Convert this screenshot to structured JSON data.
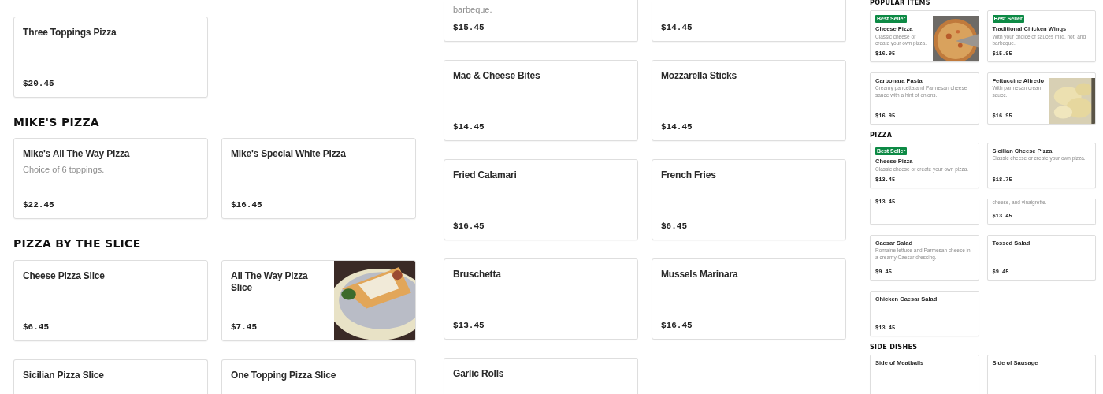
{
  "panels": [
    {
      "kind": "regular",
      "sections": [
        {
          "items": [
            {
              "kind": "full",
              "name": "Three Toppings Pizza",
              "price": "$20.45"
            }
          ]
        },
        {
          "heading": "MIKE'S PIZZA",
          "items": [
            {
              "kind": "full",
              "name": "Mike's All The Way Pizza",
              "description": "Choice of 6 toppings.",
              "price": "$22.45"
            },
            {
              "kind": "full",
              "name": "Mike's Special White Pizza",
              "price": "$16.45"
            }
          ]
        },
        {
          "heading": "PIZZA BY THE SLICE",
          "items": [
            {
              "kind": "full",
              "name": "Cheese Pizza Slice",
              "price": "$6.45"
            },
            {
              "kind": "full",
              "name": "All The Way Pizza Slice",
              "price": "$7.45",
              "picture": true
            },
            {
              "kind": "head",
              "name": "Sicilian Pizza Slice"
            },
            {
              "kind": "head",
              "name": "One Topping Pizza Slice"
            }
          ]
        }
      ]
    },
    {
      "kind": "regular",
      "sections": [
        {
          "items": [
            {
              "kind": "tail",
              "description": "barbeque.",
              "price": "$15.45"
            },
            {
              "kind": "tail",
              "price": "$14.45"
            },
            {
              "kind": "full",
              "name": "Mac & Cheese Bites",
              "price": "$14.45"
            },
            {
              "kind": "full",
              "name": "Mozzarella Sticks",
              "price": "$14.45"
            },
            {
              "kind": "full",
              "name": "Fried Calamari",
              "price": "$16.45"
            },
            {
              "kind": "full",
              "name": "French Fries",
              "price": "$6.45"
            },
            {
              "kind": "full",
              "name": "Bruschetta",
              "price": "$13.45"
            },
            {
              "kind": "full",
              "name": "Mussels Marinara",
              "price": "$16.45"
            },
            {
              "kind": "head",
              "name": "Garlic Rolls"
            }
          ]
        }
      ]
    },
    {
      "kind": "compact",
      "sections": [
        {
          "heading": "POPULAR ITEMS",
          "items": [
            {
              "kind": "full",
              "badge": "Best Seller",
              "name": "Cheese Pizza",
              "description": "Classic cheese or create your own pizza.",
              "price": "$16.95",
              "picture": true
            },
            {
              "kind": "full",
              "badge": "Best Seller",
              "name": "Traditional Chicken Wings",
              "description": "With your choice of sauces mild, hot, and barbeque.",
              "price": "$15.95"
            },
            {
              "kind": "full",
              "name": "Carbonara Pasta",
              "description": "Creamy pancetta and Parmesan cheese sauce with a hint of onions.",
              "price": "$16.95"
            },
            {
              "kind": "full",
              "name": "Fettuccine Alfredo",
              "description": "With parmesan cream sauce.",
              "price": "$16.95",
              "picture": true
            }
          ]
        },
        {
          "heading": "PIZZA",
          "items": [
            {
              "kind": "full",
              "badge": "Best Seller",
              "name": "Cheese Pizza",
              "description": "Classic cheese or create your own pizza.",
              "price": "$13.45"
            },
            {
              "kind": "full",
              "name": "Sicilian Cheese Pizza",
              "description": "Classic cheese or create your own pizza.",
              "price": "$18.75"
            },
            {
              "kind": "tail",
              "price": "$13.45"
            },
            {
              "kind": "tail",
              "description": "cheese, and vinaigrette.",
              "price": "$13.45"
            },
            {
              "kind": "full",
              "name": "Caesar Salad",
              "description": "Romaine lettuce and Parmesan cheese in a creamy Caesar dressing.",
              "price": "$9.45"
            },
            {
              "kind": "full",
              "name": "Tossed Salad",
              "price": "$9.45"
            },
            {
              "kind": "full",
              "name": "Chicken Caesar Salad",
              "price": "$13.45"
            }
          ]
        },
        {
          "heading": "SIDE DISHES",
          "items": [
            {
              "kind": "head",
              "name": "Side of Meatballs"
            },
            {
              "kind": "head",
              "name": "Side of Sausage"
            }
          ]
        }
      ]
    }
  ]
}
